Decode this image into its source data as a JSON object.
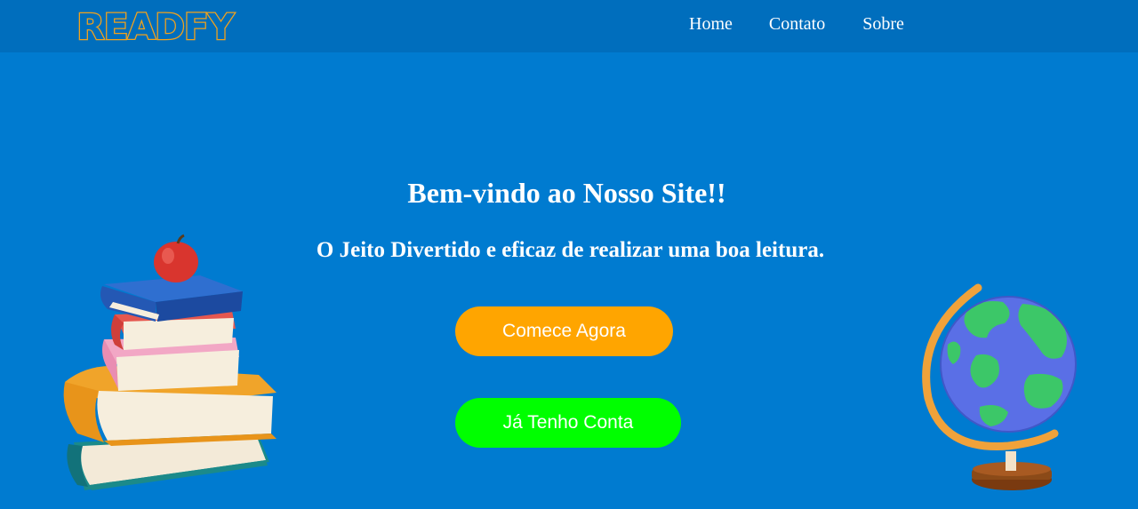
{
  "brand": {
    "logo_text": "READFY"
  },
  "nav": {
    "items": [
      {
        "label": "Home"
      },
      {
        "label": "Contato"
      },
      {
        "label": "Sobre"
      }
    ]
  },
  "hero": {
    "title": "Bem-vindo ao Nosso Site!!",
    "subtitle": "O Jeito Divertido e eficaz de realizar uma boa leitura.",
    "start_button": "Comece Agora",
    "login_button": "Já Tenho Conta"
  },
  "colors": {
    "background": "#007bd0",
    "navbar": "#006ebd",
    "logo_outline": "#f2a21c",
    "start_button": "#ffa500",
    "login_button": "#00ff00"
  },
  "images": {
    "left": "books-with-apple-illustration",
    "right": "globe-illustration"
  }
}
